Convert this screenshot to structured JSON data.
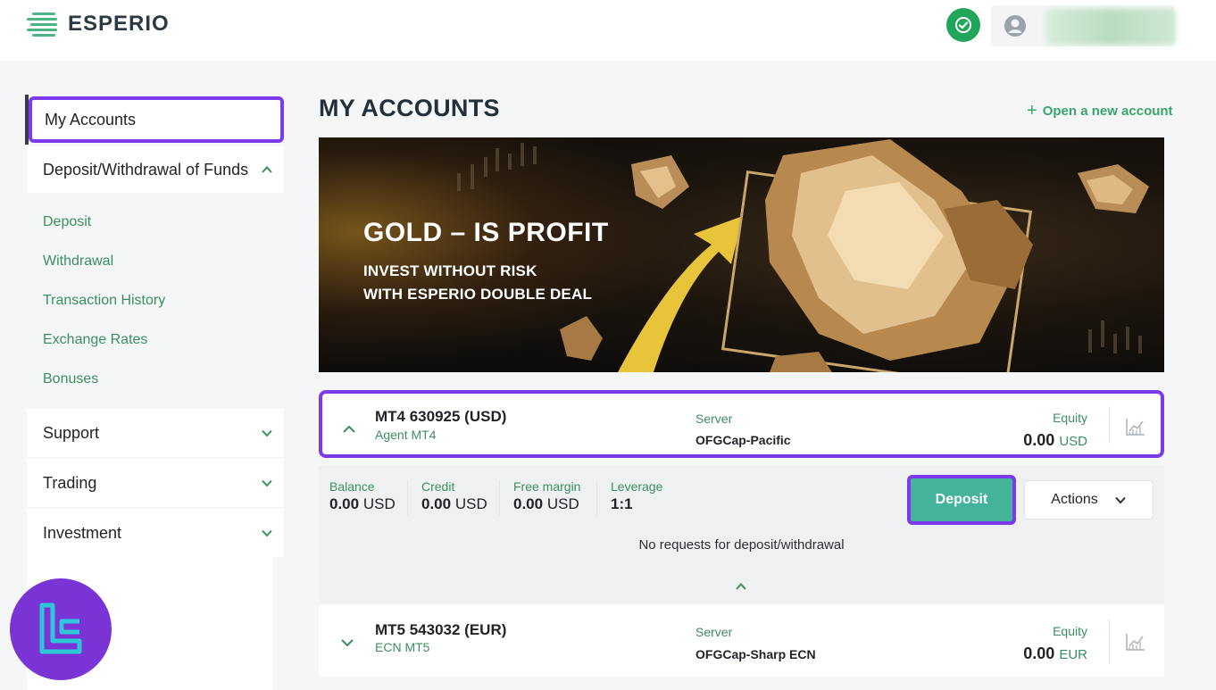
{
  "header": {
    "brand": "ESPERIO",
    "verified_icon": "check-badge-icon",
    "avatar_icon": "user-avatar-icon"
  },
  "sidebar": {
    "my_accounts": "My Accounts",
    "funds": {
      "label": "Deposit/Withdrawal of Funds",
      "items": [
        "Deposit",
        "Withdrawal",
        "Transaction History",
        "Exchange Rates",
        "Bonuses"
      ]
    },
    "support": "Support",
    "trading": "Trading",
    "investment": "Investment"
  },
  "main": {
    "title": "MY ACCOUNTS",
    "open_account": "Open a new account",
    "banner": {
      "title": "GOLD – IS PROFIT",
      "line1": "INVEST WITHOUT RISK",
      "line2": "WITH ESPERIO DOUBLE DEAL"
    },
    "accounts": [
      {
        "name": "MT4 630925 (USD)",
        "type": "Agent MT4",
        "server_label": "Server",
        "server": "OFGCap-Pacific",
        "equity_label": "Equity",
        "equity": "0.00",
        "currency": "USD"
      },
      {
        "name": "MT5 543032 (EUR)",
        "type": "ECN MT5",
        "server_label": "Server",
        "server": "OFGCap-Sharp ECN",
        "equity_label": "Equity",
        "equity": "0.00",
        "currency": "EUR"
      }
    ],
    "details": {
      "balance_label": "Balance",
      "balance": "0.00",
      "balance_cur": "USD",
      "credit_label": "Credit",
      "credit": "0.00",
      "credit_cur": "USD",
      "free_margin_label": "Free margin",
      "free_margin": "0.00",
      "free_margin_cur": "USD",
      "leverage_label": "Leverage",
      "leverage": "1:1",
      "deposit_button": "Deposit",
      "actions_button": "Actions",
      "no_requests": "No requests for deposit/withdrawal"
    }
  },
  "colors": {
    "accent_green": "#3c8f5e",
    "deposit_button": "#44b39b",
    "highlight_purple": "#7c3aed",
    "verified_green": "#1fa65a"
  }
}
